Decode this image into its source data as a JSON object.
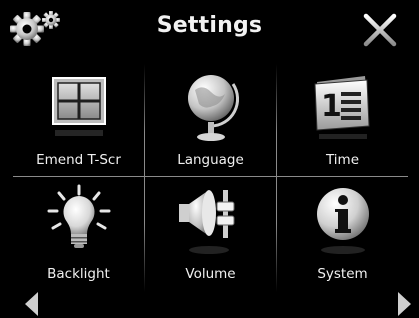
{
  "header": {
    "title": "Settings",
    "logo_icon": "gears-icon",
    "close_icon": "close-icon"
  },
  "tiles": [
    {
      "label": "Emend T-Scr",
      "icon": "touchscreen-calibrate-icon"
    },
    {
      "label": "Language",
      "icon": "globe-icon"
    },
    {
      "label": "Time",
      "icon": "calendar-icon"
    },
    {
      "label": "Backlight",
      "icon": "lightbulb-icon"
    },
    {
      "label": "Volume",
      "icon": "speaker-volume-icon"
    },
    {
      "label": "System",
      "icon": "info-icon"
    }
  ],
  "nav": {
    "prev_icon": "arrow-left-icon",
    "next_icon": "arrow-right-icon"
  },
  "colors": {
    "background": "#000000",
    "divider": "#8a8a8a",
    "text": "#f0f0f0"
  }
}
